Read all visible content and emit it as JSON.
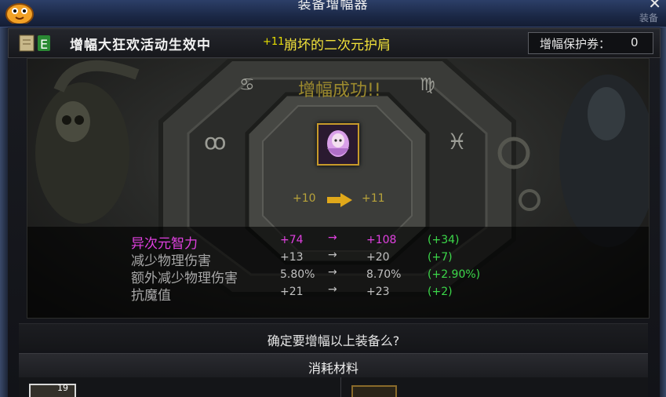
{
  "window": {
    "title": "装备增幅器",
    "close_symbol": "✕",
    "right_label": "装备"
  },
  "header": {
    "event_text": "增幅大狂欢活动生效中",
    "item_level": "+11",
    "item_name": "崩坏的二次元护肩",
    "protect_label": "增幅保护券：",
    "protect_value": "0"
  },
  "result": {
    "text": "增幅成功!!",
    "from_level": "+10",
    "to_level": "+11"
  },
  "stats": [
    {
      "name": "异次元智力",
      "old": "+74",
      "arrow": "→",
      "new": "+108",
      "delta": "(+34)"
    },
    {
      "name": "减少物理伤害",
      "old": "+13",
      "arrow": "→",
      "new": "+20",
      "delta": "(+7)"
    },
    {
      "name": "额外减少物理伤害",
      "old": "5.80%",
      "arrow": "→",
      "new": "8.70%",
      "delta": "(+2.90%)"
    },
    {
      "name": "抗魔值",
      "old": "+21",
      "arrow": "→",
      "new": "+23",
      "delta": "(+2)"
    }
  ],
  "confirm_text": "确定要增幅以上装备么?",
  "materials": {
    "header": "消耗材料",
    "left_count": "19"
  },
  "icons": [
    "mascot-icon",
    "event-scroll-icon",
    "item-shoulder-icon",
    "arrow-right-icon",
    "close-icon"
  ]
}
